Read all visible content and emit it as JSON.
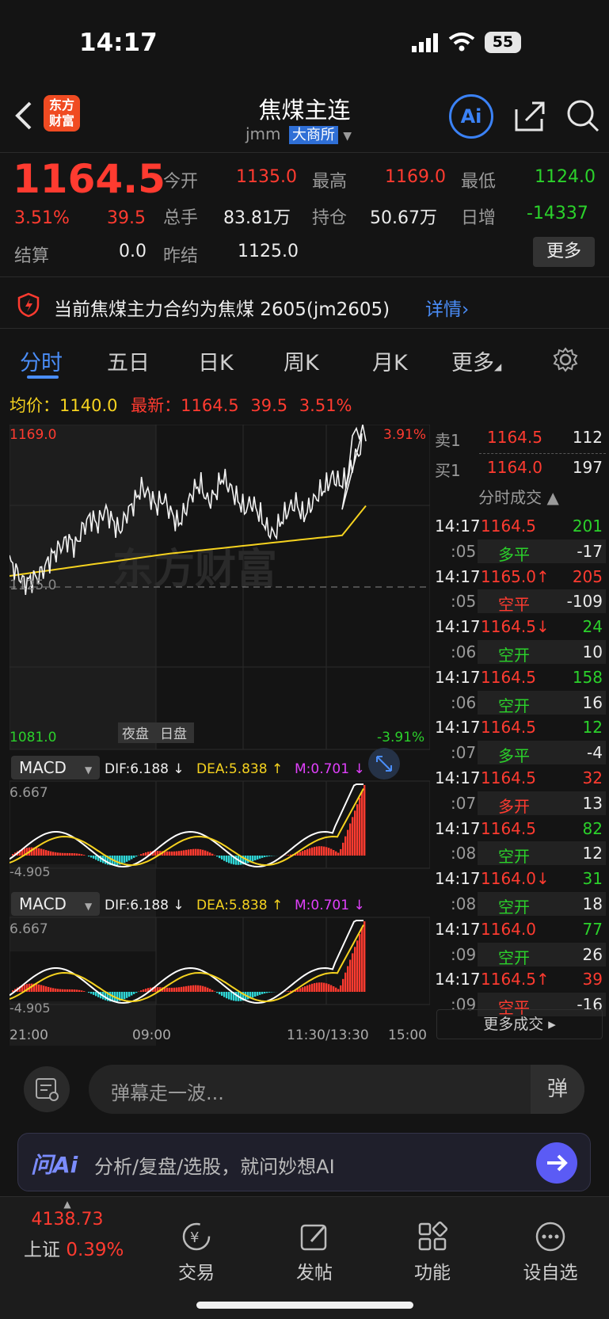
{
  "status": {
    "time": "14:17",
    "battery": "55"
  },
  "header": {
    "logo_line1": "东方",
    "logo_line2": "财富",
    "title": "焦煤主连",
    "code": "jmm",
    "exchange": "大商所",
    "ai_label": "Ai"
  },
  "quote": {
    "price": "1164.5",
    "pct": "3.51%",
    "chg": "39.5",
    "open_label": "今开",
    "open": "1135.0",
    "high_label": "最高",
    "high": "1169.0",
    "low_label": "最低",
    "low": "1124.0",
    "vol_label": "总手",
    "vol": "83.81万",
    "oi_label": "持仓",
    "oi": "50.67万",
    "inc_label": "日增",
    "inc": "-14337",
    "settle_label": "结算",
    "settle": "0.0",
    "prev_label": "昨结",
    "prev": "1125.0",
    "more": "更多"
  },
  "notice": {
    "text": "当前焦煤主力合约为焦煤 2605(jm2605)",
    "link": "详情"
  },
  "tabs": [
    "分时",
    "五日",
    "日K",
    "周K",
    "月K",
    "更多"
  ],
  "info": {
    "avg_label": "均价：",
    "avg": "1140.0",
    "last_label": "最新：",
    "last": "1164.5",
    "chg": "39.5",
    "pct": "3.51%"
  },
  "chart": {
    "ymax": "1169.0",
    "ymin": "1081.0",
    "mid": "1125.0",
    "pmax": "3.91%",
    "pmin": "-3.91%",
    "night": "夜盘",
    "day": "日盘",
    "xticks": [
      "21:00",
      "09:00",
      "11:30/13:30",
      "15:00"
    ],
    "watermark": "东方财富"
  },
  "macd1": {
    "name": "MACD",
    "dif": "DIF:6.188 ↓",
    "dea": "DEA:5.838 ↑",
    "m": "M:0.701 ↓",
    "top": "6.667",
    "bot": "-4.905"
  },
  "macd2": {
    "name": "MACD",
    "dif": "DIF:6.188 ↓",
    "dea": "DEA:5.838 ↑",
    "m": "M:0.701 ↓",
    "top": "6.667",
    "bot": "-4.905"
  },
  "book": {
    "sell_label": "卖1",
    "sell_price": "1164.5",
    "sell_vol": "112",
    "buy_label": "买1",
    "buy_price": "1164.0",
    "buy_vol": "197",
    "title": "分时成交 ▲"
  },
  "trades": [
    {
      "t": "14:17",
      "p": "1164.5",
      "v": "201",
      "pc": "red",
      "vc": "green"
    },
    {
      "t": ":05",
      "p": "多平",
      "v": "-17",
      "pc": "green",
      "vc": "white"
    },
    {
      "t": "14:17",
      "p": "1165.0↑",
      "v": "205",
      "pc": "red",
      "vc": "red"
    },
    {
      "t": ":05",
      "p": "空平",
      "v": "-109",
      "pc": "red",
      "vc": "white"
    },
    {
      "t": "14:17",
      "p": "1164.5↓",
      "v": "24",
      "pc": "red",
      "vc": "green"
    },
    {
      "t": ":06",
      "p": "空开",
      "v": "10",
      "pc": "green",
      "vc": "white"
    },
    {
      "t": "14:17",
      "p": "1164.5",
      "v": "158",
      "pc": "red",
      "vc": "green"
    },
    {
      "t": ":06",
      "p": "空开",
      "v": "16",
      "pc": "green",
      "vc": "white"
    },
    {
      "t": "14:17",
      "p": "1164.5",
      "v": "12",
      "pc": "red",
      "vc": "green"
    },
    {
      "t": ":07",
      "p": "多平",
      "v": "-4",
      "pc": "green",
      "vc": "white"
    },
    {
      "t": "14:17",
      "p": "1164.5",
      "v": "32",
      "pc": "red",
      "vc": "red"
    },
    {
      "t": ":07",
      "p": "多开",
      "v": "13",
      "pc": "red",
      "vc": "white"
    },
    {
      "t": "14:17",
      "p": "1164.5",
      "v": "82",
      "pc": "red",
      "vc": "green"
    },
    {
      "t": ":08",
      "p": "空开",
      "v": "12",
      "pc": "green",
      "vc": "white"
    },
    {
      "t": "14:17",
      "p": "1164.0↓",
      "v": "31",
      "pc": "red",
      "vc": "green"
    },
    {
      "t": ":08",
      "p": "空开",
      "v": "18",
      "pc": "green",
      "vc": "white"
    },
    {
      "t": "14:17",
      "p": "1164.0",
      "v": "77",
      "pc": "red",
      "vc": "green"
    },
    {
      "t": ":09",
      "p": "空开",
      "v": "26",
      "pc": "green",
      "vc": "white"
    },
    {
      "t": "14:17",
      "p": "1164.5↑",
      "v": "39",
      "pc": "red",
      "vc": "red"
    },
    {
      "t": ":09",
      "p": "空平",
      "v": "-16",
      "pc": "red",
      "vc": "white"
    }
  ],
  "more_trades": "更多成交 ▸",
  "danmu": {
    "placeholder": "弹幕走一波...",
    "btn": "弹"
  },
  "ai": {
    "logo": "问Ai",
    "text": "分析/复盘/选股，就问妙想AI"
  },
  "nav": {
    "index_value": "4138.73",
    "index_name": "上证",
    "index_pct": "0.39%",
    "trade": "交易",
    "post": "发帖",
    "func": "功能",
    "watch": "设自选"
  }
}
